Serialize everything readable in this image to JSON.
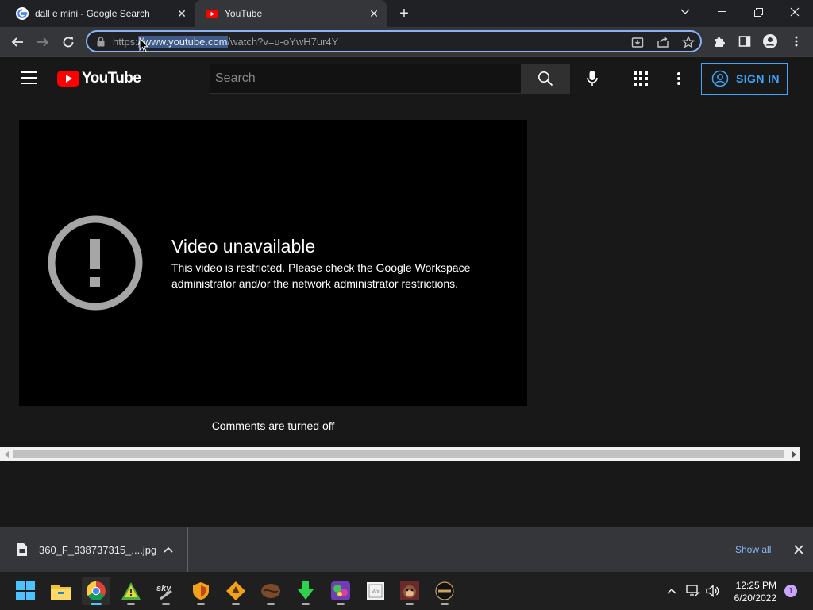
{
  "browser": {
    "tabs": [
      {
        "title": "dall e mini - Google Search",
        "active": false,
        "favicon": "google-favicon"
      },
      {
        "title": "YouTube",
        "active": true,
        "favicon": "youtube-favicon"
      }
    ],
    "url": {
      "scheme": "https:",
      "selected": "//www.youtube.com",
      "rest": "/watch?v=u-oYwH7ur4Y"
    }
  },
  "youtube": {
    "logo_text": "YouTube",
    "search_placeholder": "Search",
    "signin_label": "SIGN IN",
    "error": {
      "title": "Video unavailable",
      "message": "This video is restricted. Please check the Google Workspace administrator and/or the network administrator restrictions."
    },
    "comments_text": "Comments are turned off"
  },
  "downloads": {
    "file_name": "360_F_338737315_....jpg",
    "show_all": "Show all"
  },
  "taskbar": {
    "time": "12:25 PM",
    "date": "6/20/2022",
    "notification_count": "1",
    "apps": [
      "start-icon",
      "file-explorer-icon",
      "chrome-icon",
      "warning-app-icon",
      "sky-app-icon",
      "shield-app-icon",
      "hazard-app-icon",
      "coffee-app-icon",
      "download-app-icon",
      "game-app-icon",
      "wii-app-icon",
      "monkey-app-icon",
      "kings-app-icon"
    ]
  },
  "colors": {
    "accent": "#3ea6ff",
    "youtube_red": "#ff0000",
    "page_bg": "#181818"
  }
}
